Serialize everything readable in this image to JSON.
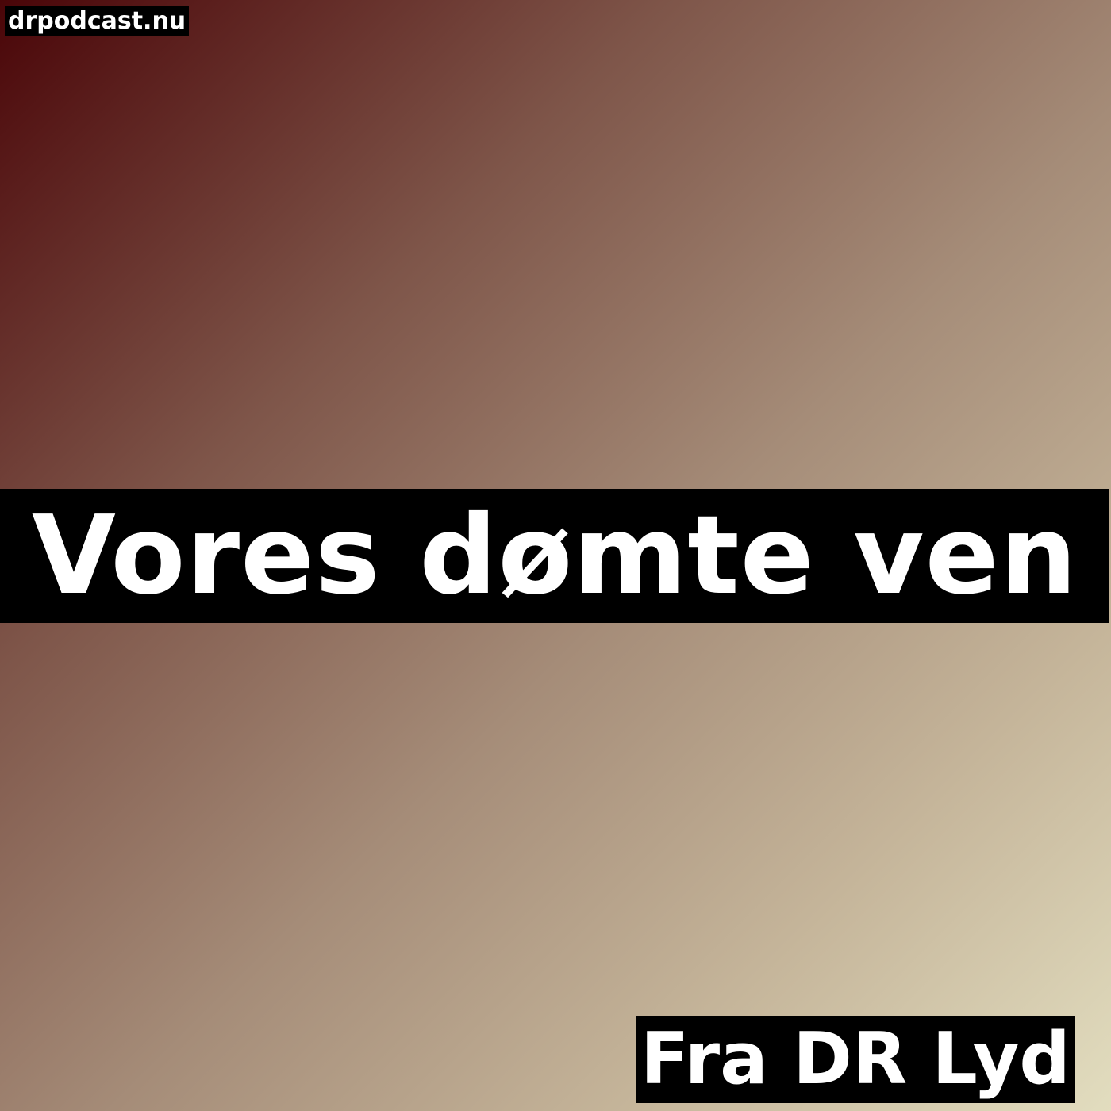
{
  "site": {
    "label": "drpodcast.nu"
  },
  "podcast": {
    "title": "Vores dømte ven",
    "source": "Fra DR Lyd"
  },
  "colors": {
    "gradient_start": "#4a0508",
    "gradient_end": "#e2ddbf",
    "band_background": "#000000",
    "text": "#ffffff"
  }
}
